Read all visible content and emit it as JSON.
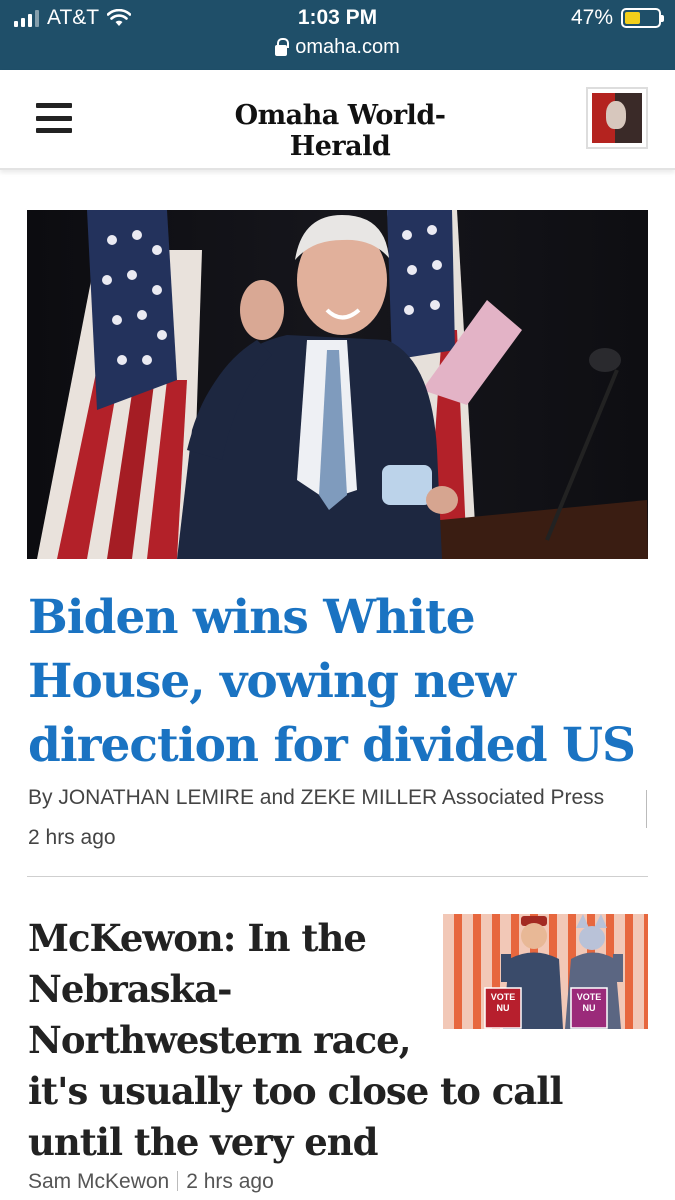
{
  "status_bar": {
    "carrier": "AT&T",
    "time": "1:03 PM",
    "battery_percent": "47%",
    "battery_level": 0.47,
    "url": "omaha.com"
  },
  "header": {
    "site_name": "Omaha World-Herald"
  },
  "lead_story": {
    "headline": "Biden wins White House, vowing new direction for divided US",
    "byline": "By JONATHAN LEMIRE and ZEKE MILLER Associated Press",
    "time_ago": "2 hrs ago"
  },
  "second_story": {
    "headline_line1": "McKewon: In the Nebraska-Northwestern race,",
    "headline_line2": "it's usually too close to call until the very end",
    "image_text_left": "VOTE NU",
    "image_text_right": "VOTE NU",
    "author": "Sam McKewon",
    "time_ago": "2 hrs ago"
  },
  "colors": {
    "status_bar_bg": "#1f4f69",
    "headline_blue": "#1a73c2",
    "battery_yellow": "#f3cf1b"
  }
}
